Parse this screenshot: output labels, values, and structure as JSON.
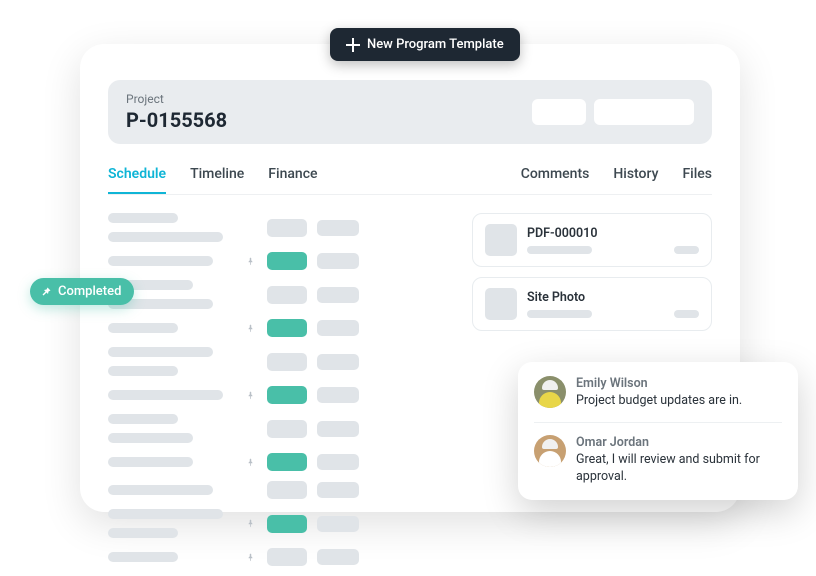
{
  "topButton": {
    "label": "New Program Template"
  },
  "header": {
    "label": "Project",
    "value": "P-0155568"
  },
  "tabsLeft": [
    {
      "label": "Schedule",
      "active": true
    },
    {
      "label": "Timeline",
      "active": false
    },
    {
      "label": "Finance",
      "active": false
    }
  ],
  "tabsRight": [
    {
      "label": "Comments"
    },
    {
      "label": "History"
    },
    {
      "label": "Files"
    }
  ],
  "scheduleRows": [
    {
      "pin": false,
      "green": false,
      "lines": [
        "a",
        "c"
      ]
    },
    {
      "pin": true,
      "green": true,
      "lines": [
        "b"
      ]
    },
    {
      "pin": false,
      "green": false,
      "lines": [
        "d",
        "b"
      ]
    },
    {
      "pin": true,
      "green": true,
      "lines": [
        "a"
      ]
    },
    {
      "pin": false,
      "green": false,
      "lines": [
        "b",
        "a"
      ]
    },
    {
      "pin": true,
      "green": true,
      "lines": [
        "c"
      ]
    },
    {
      "pin": false,
      "green": false,
      "lines": [
        "a",
        "d"
      ]
    },
    {
      "pin": true,
      "green": true,
      "lines": [
        "d"
      ]
    },
    {
      "pin": false,
      "green": false,
      "lines": [
        "b"
      ]
    },
    {
      "pin": true,
      "green": true,
      "lines": [
        "c",
        "a"
      ]
    },
    {
      "pin": true,
      "green": false,
      "lines": [
        "a"
      ]
    }
  ],
  "sideCards": [
    {
      "title": "PDF-000010"
    },
    {
      "title": "Site Photo"
    }
  ],
  "badge": {
    "label": "Completed"
  },
  "comments": [
    {
      "name": "Emily Wilson",
      "text": "Project budget updates are in."
    },
    {
      "name": "Omar Jordan",
      "text": "Great, I will review and submit for approval."
    }
  ]
}
